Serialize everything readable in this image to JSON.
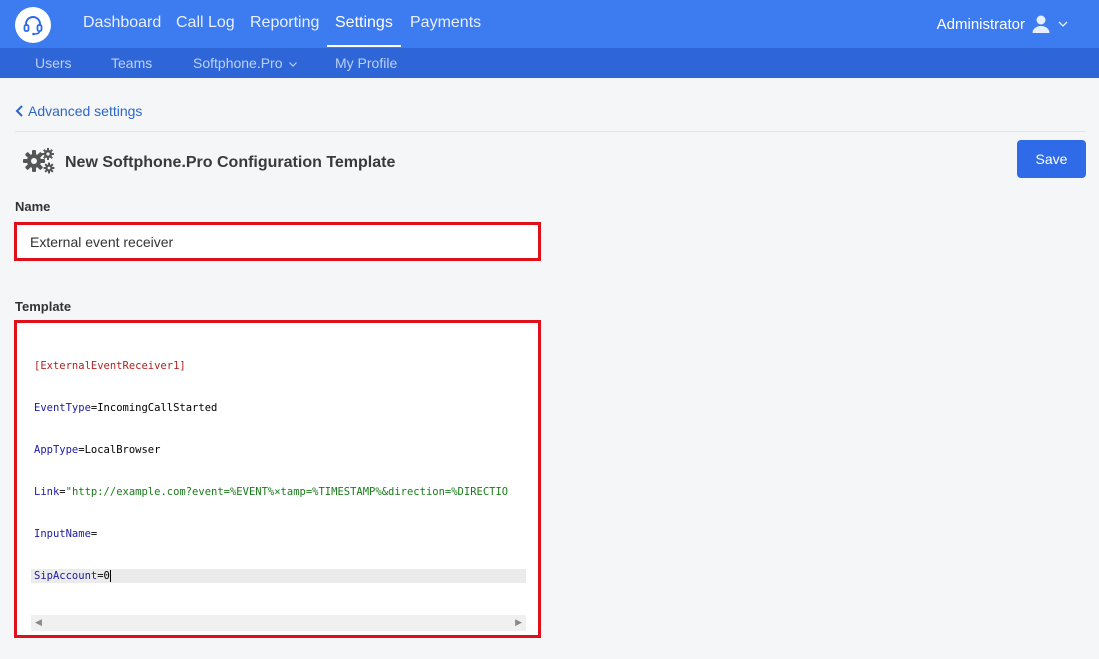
{
  "header": {
    "logo_icon": "headset-icon",
    "nav": [
      "Dashboard",
      "Call Log",
      "Reporting",
      "Settings",
      "Payments"
    ],
    "active_nav": "Settings",
    "user_name": "Administrator",
    "user_icon": "user-icon"
  },
  "subnav": {
    "items": [
      "Users",
      "Teams",
      "Softphone.Pro",
      "My Profile"
    ]
  },
  "breadcrumb": {
    "back_label": "Advanced settings"
  },
  "page": {
    "title": "New Softphone.Pro Configuration Template",
    "title_icon": "gears-icon",
    "save_label": "Save"
  },
  "form": {
    "name_label": "Name",
    "name_value": "External event receiver",
    "template_label": "Template",
    "template_lines": [
      "[ExternalEventReceiver1]",
      "EventType=IncomingCallStarted",
      "AppType=LocalBrowser",
      "Link=\"http://example.com?event=%EVENT%×tamp=%TIMESTAMP%&direction=%DIRECTIO",
      "InputName=",
      "SipAccount=0"
    ],
    "template_parts": {
      "section": "[ExternalEventReceiver1]",
      "k1": "EventType",
      "v1": "IncomingCallStarted",
      "k2": "AppType",
      "v2": "LocalBrowser",
      "k3": "Link",
      "v3": "\"http://example.com?event=%EVENT%×tamp=%TIMESTAMP%&direction=%DIRECTIO",
      "k4": "InputName",
      "v4": "",
      "k5": "SipAccount",
      "v5": "0"
    }
  },
  "colors": {
    "header_bg": "#3d7bf0",
    "subnav_bg": "#2e66d8",
    "accent": "#2f6be8",
    "highlight_border": "#e0101a"
  }
}
